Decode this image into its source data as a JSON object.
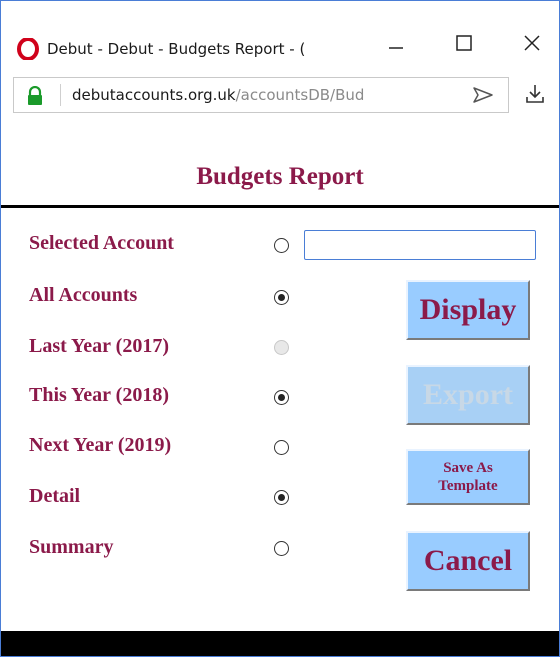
{
  "window": {
    "title": "Debut - Debut - Budgets Report - (",
    "buttons": {
      "minimize_icon": "minimize-icon",
      "maximize_icon": "maximize-icon",
      "close_icon": "close-icon"
    }
  },
  "address_bar": {
    "host": "debutaccounts.org.uk",
    "path": "/accountsDB/Bud",
    "lock_icon": "lock-icon",
    "send_icon": "send-icon",
    "download_icon": "download-icon"
  },
  "page": {
    "title": "Budgets Report",
    "options": [
      {
        "label": "Selected Account",
        "state": "unchecked"
      },
      {
        "label": "All Accounts",
        "state": "checked"
      },
      {
        "label": "Last Year (2017)",
        "state": "disabled"
      },
      {
        "label": "This Year (2018)",
        "state": "checked"
      },
      {
        "label": "Next Year (2019)",
        "state": "unchecked"
      },
      {
        "label": "Detail",
        "state": "checked"
      },
      {
        "label": "Summary",
        "state": "unchecked"
      }
    ],
    "account_input": {
      "value": "",
      "placeholder": ""
    },
    "buttons": {
      "display": "Display",
      "export": "Export",
      "save_template": "Save As\nTemplate",
      "cancel": "Cancel"
    }
  },
  "colors": {
    "label_text": "#8b1a4a",
    "button_bg": "#99ccff",
    "input_border": "#4a7ed6",
    "lock_green": "#1a9a2a",
    "opera_red": "#d0021b"
  }
}
